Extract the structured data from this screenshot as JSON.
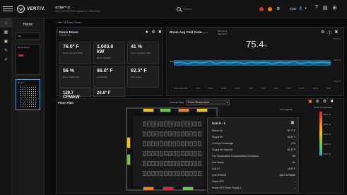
{
  "app": {
    "logo_text": "VERTIV.",
    "site_name": "ICOM™-S",
    "site_sub": "XXX.XXX.XXX.XXX  •  Admin 2.1  •  FW 2.0.0.1"
  },
  "search": {
    "placeholder": "Search"
  },
  "user": {
    "name": "Tyler"
  },
  "home": {
    "title": "Home",
    "thumb1": "Site",
    "thumb2": "Demo Room",
    "thumb3": "Room 1"
  },
  "breadcrumb": "⌂  Site  /  ⊞  Demo Room  ⌄",
  "demo_room": {
    "title": "Demo Room",
    "subtitle": "Parent: Site",
    "metrics": [
      {
        "value": "76.0° F",
        "label": "Room Avg Cold Aisle"
      },
      {
        "value": "1,003.0 kW",
        "label": "Room Capacity"
      },
      {
        "value": "41 %",
        "label": "Room Capacity Used"
      },
      {
        "value": "56 %",
        "label": "Room CFM Used"
      },
      {
        "value": "86.0° F",
        "label": "Unit Return"
      },
      {
        "value": "62.3° F",
        "label": "Unit Supply"
      },
      {
        "value": "129.7 CFM/kW",
        "label": ""
      },
      {
        "value": "24.6° F",
        "label": ""
      }
    ]
  },
  "cold_aisle": {
    "title": "Room Avg Cold Aisle",
    "range_label": "Day  1d",
    "min_label": "Min  Get 1",
    "max_label": "Max  Get 1",
    "value": "75.4",
    "unit": "°F",
    "y_top": "80.0 °F",
    "y_mid": "80.0 °F",
    "y_low": "60.0 °F",
    "series_label": "Good",
    "x_ticks": [
      "4:00\n11/05 AM",
      "6:00",
      "8:00",
      "10:00",
      "12:00",
      "2:00",
      "4:00",
      "6:00",
      "8:00",
      "10:00",
      "12:00",
      "2:00"
    ]
  },
  "floor_plan": {
    "title": "Floor Plan",
    "view_label": "Current View",
    "view_value": "Room Temperature",
    "legend_title": "Room Temperature",
    "legend_ticks": [
      "90.0 °F",
      "80.0 °F",
      "70.0 °F",
      "60.0 °F",
      "50.0 °F"
    ],
    "unit_legend": "Unit Capacity"
  },
  "popup": {
    "title": "Unit 5 - 1",
    "rows": [
      {
        "k": "Return Air",
        "v": "87.7° F"
      },
      {
        "k": "Supply Air",
        "v": "61.8° F"
      },
      {
        "k": "Cooling Percentage",
        "v": "0 %"
      },
      {
        "k": "Supply Air Setpoint",
        "v": "61.8° F"
      },
      {
        "k": "Fan Temperature Compensation Limit Alarm",
        "v": "Off"
      },
      {
        "k": "Unit Status",
        "v": "On"
      },
      {
        "k": "Unit ΔT",
        "v": "19.8° F"
      },
      {
        "k": "Unit CFM/kW",
        "v": "142.1 CFM/kW"
      },
      {
        "k": "Status ATS",
        "v": "–"
      },
      {
        "k": "Status ATS Power Supply 1",
        "v": "–"
      }
    ]
  },
  "colors": {
    "accent": "#5aa0d0",
    "alarm_red": "#d32f2f",
    "alarm_orange": "#f57c00",
    "chart_line": "#2a9fd6"
  }
}
